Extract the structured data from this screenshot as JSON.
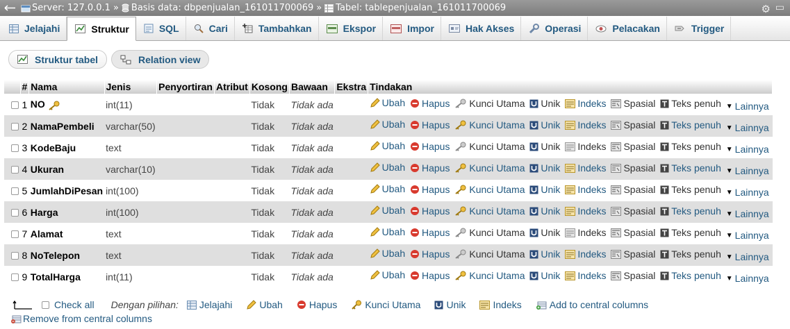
{
  "breadcrumb": {
    "server": "Server: 127.0.0.1",
    "database": "Basis data: dbpenjualan_161011700069",
    "table": "Tabel: tablepenjualan_161011700069",
    "separator": "»"
  },
  "tabs": [
    {
      "label": "Jelajahi",
      "icon": "browse-icon"
    },
    {
      "label": "Struktur",
      "icon": "structure-icon",
      "active": true
    },
    {
      "label": "SQL",
      "icon": "sql-icon"
    },
    {
      "label": "Cari",
      "icon": "search-icon"
    },
    {
      "label": "Tambahkan",
      "icon": "insert-icon"
    },
    {
      "label": "Ekspor",
      "icon": "export-icon"
    },
    {
      "label": "Impor",
      "icon": "import-icon"
    },
    {
      "label": "Hak Akses",
      "icon": "privileges-icon"
    },
    {
      "label": "Operasi",
      "icon": "wrench-icon"
    },
    {
      "label": "Pelacakan",
      "icon": "eye-icon"
    },
    {
      "label": "Trigger",
      "icon": "trigger-icon"
    }
  ],
  "subtabs": {
    "structure": "Struktur tabel",
    "relation": "Relation view"
  },
  "columns": [
    "#",
    "Nama",
    "Jenis",
    "Penyortiran",
    "Atribut",
    "Kosong",
    "Bawaan",
    "Ekstra",
    "Tindakan"
  ],
  "actions": [
    "Ubah",
    "Hapus",
    "Kunci Utama",
    "Unik",
    "Indeks",
    "Spasial",
    "Teks penuh",
    "Lainnya"
  ],
  "rows": [
    {
      "num": "1",
      "name": "NO",
      "key": true,
      "type": "int(11)",
      "null": "Tidak",
      "default": "Tidak ada"
    },
    {
      "num": "2",
      "name": "NamaPembeli",
      "type": "varchar(50)",
      "null": "Tidak",
      "default": "Tidak ada"
    },
    {
      "num": "3",
      "name": "KodeBaju",
      "type": "text",
      "null": "Tidak",
      "default": "Tidak ada"
    },
    {
      "num": "4",
      "name": "Ukuran",
      "type": "varchar(10)",
      "null": "Tidak",
      "default": "Tidak ada"
    },
    {
      "num": "5",
      "name": "JumlahDiPesan",
      "type": "int(100)",
      "null": "Tidak",
      "default": "Tidak ada"
    },
    {
      "num": "6",
      "name": "Harga",
      "type": "int(100)",
      "null": "Tidak",
      "default": "Tidak ada"
    },
    {
      "num": "7",
      "name": "Alamat",
      "type": "text",
      "null": "Tidak",
      "default": "Tidak ada"
    },
    {
      "num": "8",
      "name": "NoTelepon",
      "type": "text",
      "null": "Tidak",
      "default": "Tidak ada"
    },
    {
      "num": "9",
      "name": "TotalHarga",
      "type": "int(11)",
      "null": "Tidak",
      "default": "Tidak ada"
    }
  ],
  "footer": {
    "check_all": "Check all",
    "with_selected": "Dengan pilihan:",
    "items": [
      "Jelajahi",
      "Ubah",
      "Hapus",
      "Kunci Utama",
      "Unik",
      "Indeks",
      "Add to central columns"
    ],
    "remove_central": "Remove from central columns"
  },
  "colors": {
    "link": "#235a81",
    "topbar": "#8a8a8a",
    "row_alt": "#dfdfdf"
  }
}
